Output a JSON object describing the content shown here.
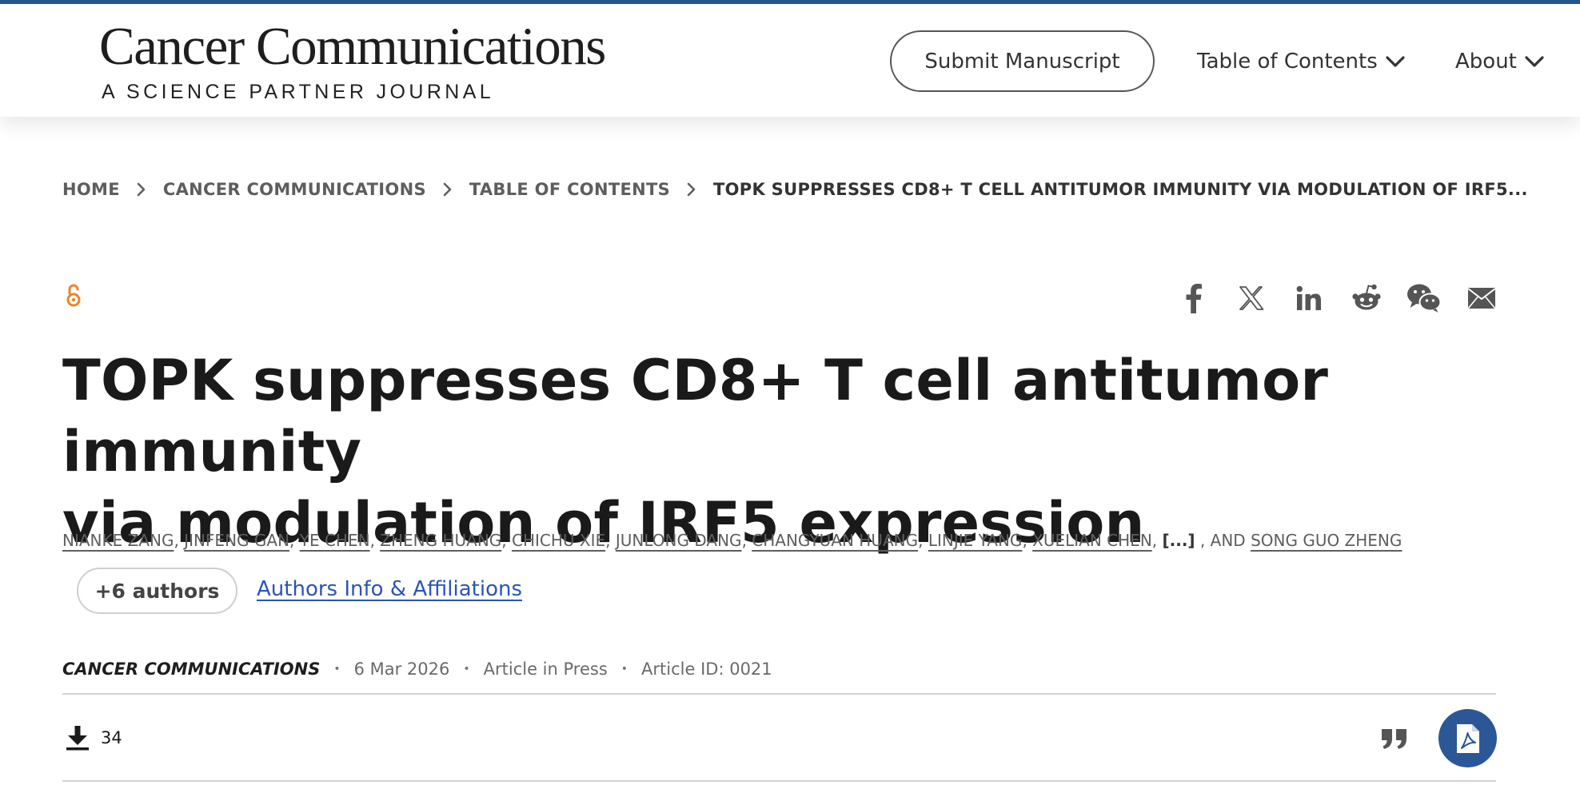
{
  "header": {
    "logo_title": "Cancer Communications",
    "logo_subtitle": "A SCIENCE PARTNER JOURNAL",
    "submit_label": "Submit Manuscript",
    "nav": [
      {
        "label": "Table of Contents",
        "icon": "chevron-down-icon"
      },
      {
        "label": "About",
        "icon": "chevron-down-icon"
      }
    ]
  },
  "breadcrumb": [
    "HOME",
    "CANCER COMMUNICATIONS",
    "TABLE OF CONTENTS",
    "TOPK SUPPRESSES CD8+ T CELL ANTITUMOR IMMUNITY VIA MODULATION OF IRF5..."
  ],
  "share_icons": [
    "facebook-icon",
    "x-icon",
    "linkedin-icon",
    "reddit-icon",
    "wechat-icon",
    "email-icon"
  ],
  "article": {
    "title_line1": "TOPK suppresses CD8+ T cell antitumor immunity",
    "title_line2": "via modulation of IRF5 expression",
    "authors": [
      "NIANKE ZANG",
      "JINFENG GAN",
      "YE CHEN",
      "ZHENG HUANG",
      "CHICHU XIE",
      "JUNLONG DANG",
      "CHANGYUAN HUANG",
      "LINJIE YANG",
      "XUELIAN CHEN"
    ],
    "authors_ellipsis": "[...]",
    "authors_and": ", AND",
    "last_author": "SONG GUO ZHENG",
    "more_authors_label": "+6 authors",
    "affiliations_label": "Authors Info & Affiliations",
    "journal": "CANCER COMMUNICATIONS",
    "date": "6 Mar 2026",
    "status": "Article in Press",
    "article_id": "Article ID: 0021",
    "meta_separator": "•",
    "downloads": "34"
  },
  "colors": {
    "brand_bar": "#24558f",
    "open_access": "#e8862c",
    "link": "#2b54b8",
    "pdf_button": "#2b5797"
  }
}
